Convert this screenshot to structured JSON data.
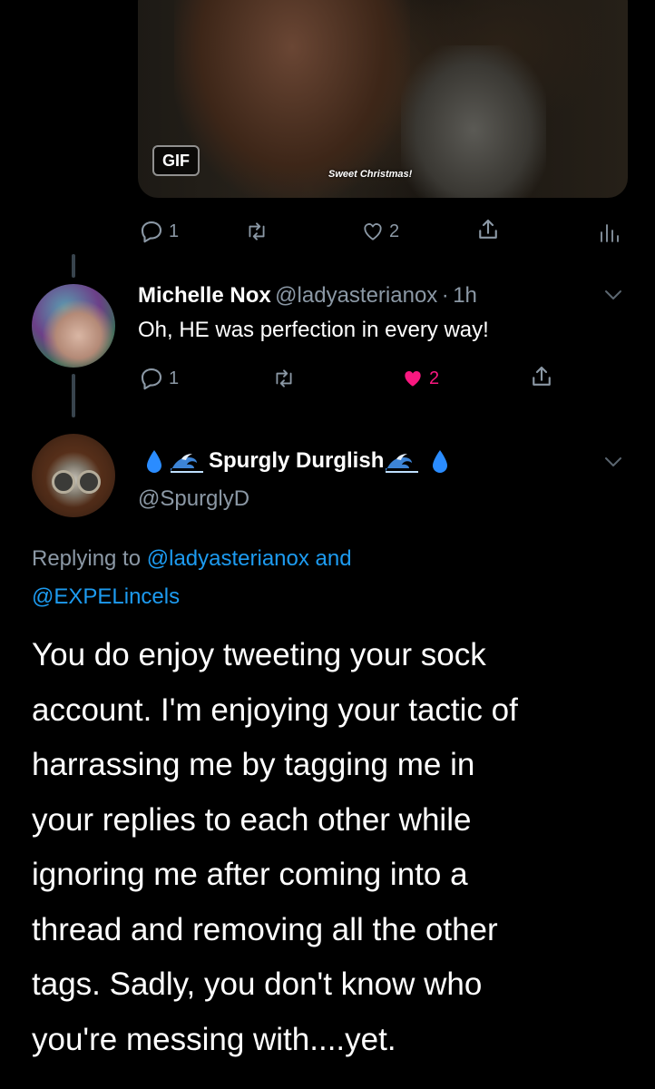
{
  "top_tweet": {
    "gif_badge": "GIF",
    "gif_caption": "Sweet Christmas!",
    "actions": {
      "reply_count": "1",
      "like_count": "2"
    }
  },
  "michelle_reply": {
    "name": "Michelle Nox",
    "handle": "@ladyasterianox",
    "separator": "·",
    "time": "1h",
    "text": "Oh, HE was perfection in every way!",
    "actions": {
      "reply_count": "1",
      "like_count": "2"
    }
  },
  "spurgly_tweet": {
    "name": "Spurgly Durglish",
    "handle": "@SpurglyD",
    "replying_prefix": "Replying to",
    "replying_user1": "@ladyasterianox",
    "replying_and": "and",
    "replying_user2": "@EXPELincels",
    "lines": [
      "You do enjoy tweeting your sock",
      "account. I'm enjoying your tactic of",
      "harrassing me by tagging me in",
      "your replies to each other while",
      "ignoring me after coming into a",
      "thread and removing all the other",
      "tags. Sadly, you don't know who",
      "you're messing with....yet."
    ]
  },
  "colors": {
    "background": "#000000",
    "secondary_text": "#8b98a5",
    "link": "#1d9bf0",
    "like_active": "#f91880",
    "thread_line": "#38444d"
  },
  "icons": [
    "reply-icon",
    "retweet-icon",
    "like-icon",
    "share-icon",
    "analytics-icon",
    "chevron-down-icon",
    "droplet-icon",
    "wave-icon"
  ]
}
